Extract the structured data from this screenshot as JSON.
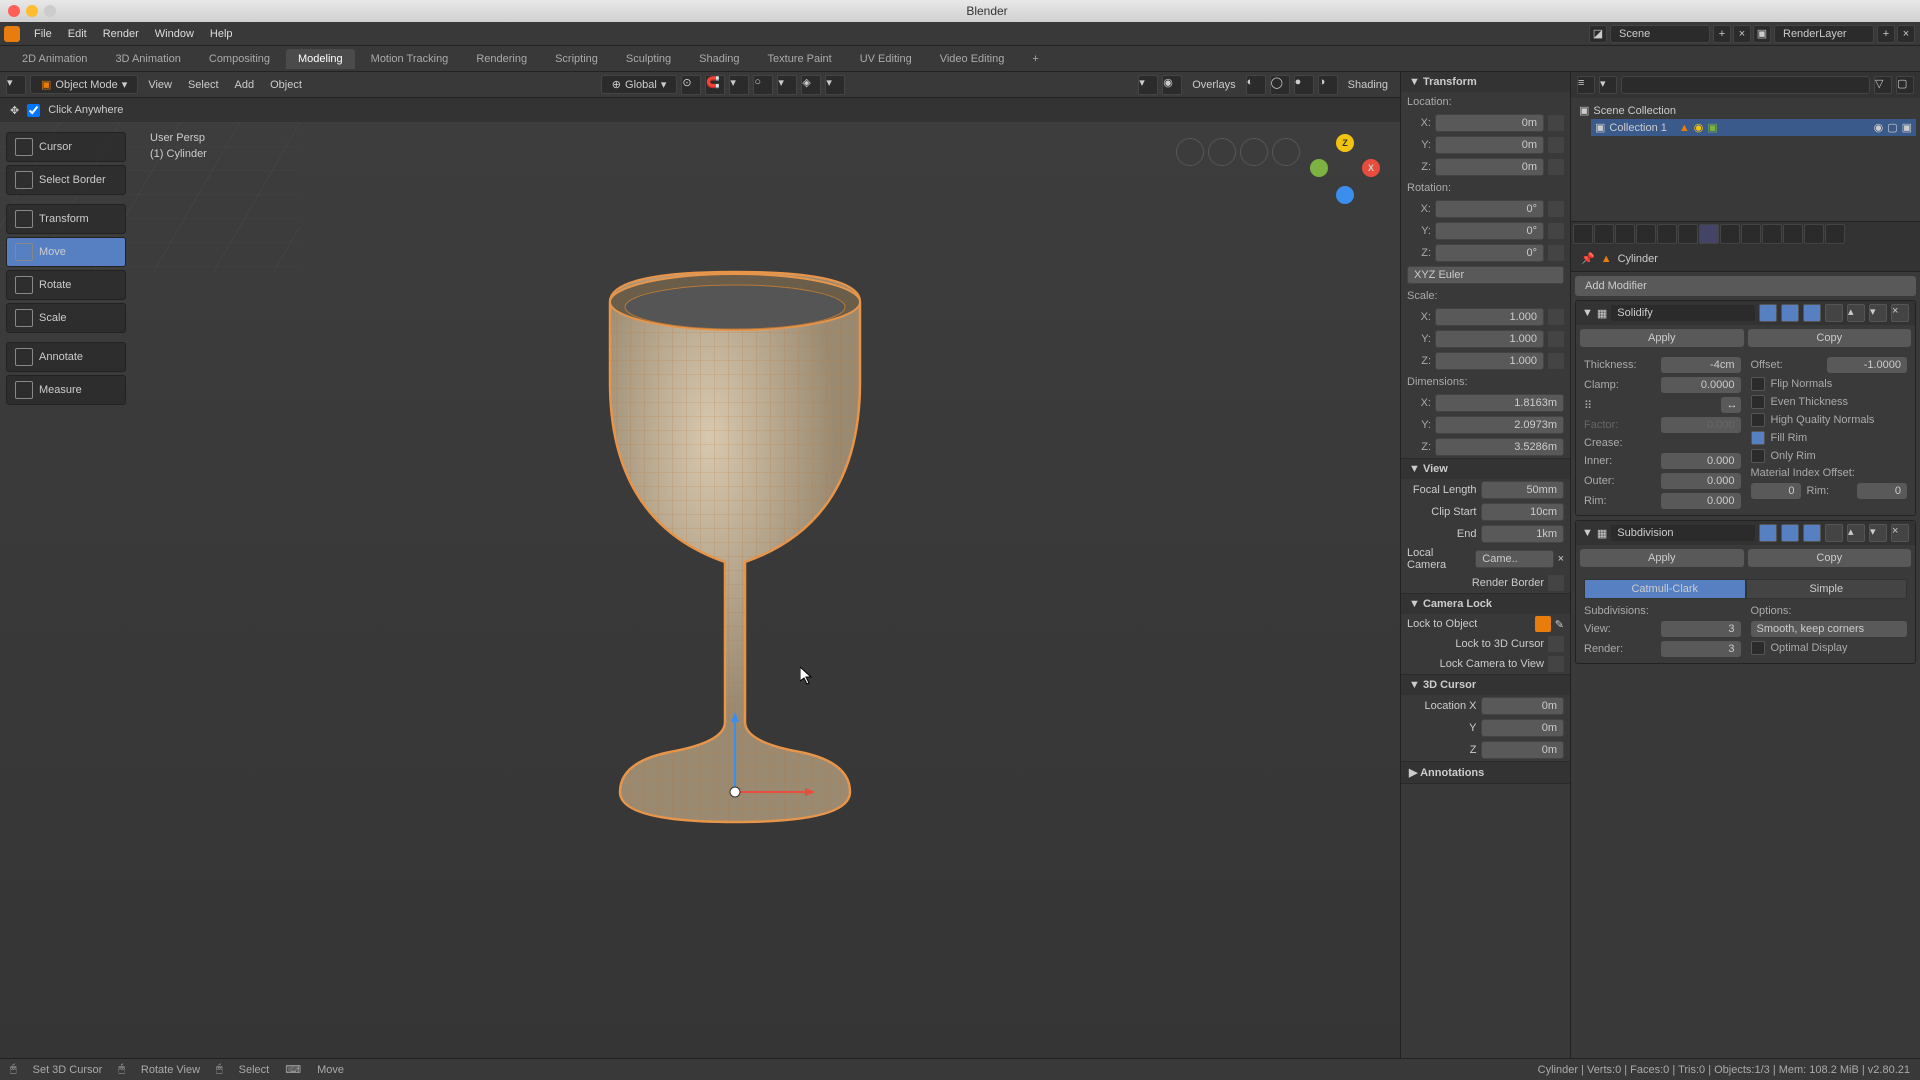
{
  "app": {
    "title": "Blender"
  },
  "menu": [
    "File",
    "Edit",
    "Render",
    "Window",
    "Help"
  ],
  "workspaces": [
    "2D Animation",
    "3D Animation",
    "Compositing",
    "Modeling",
    "Motion Tracking",
    "Rendering",
    "Scripting",
    "Sculpting",
    "Shading",
    "Texture Paint",
    "UV Editing",
    "Video Editing"
  ],
  "activeWorkspace": "Modeling",
  "scene": "Scene",
  "renderLayer": "RenderLayer",
  "vp": {
    "mode": "Object Mode",
    "menus": [
      "View",
      "Select",
      "Add",
      "Object"
    ],
    "orientation": "Global",
    "overlays": "Overlays",
    "shading": "Shading",
    "click": "Click Anywhere",
    "info1": "User Persp",
    "info2": "(1) Cylinder"
  },
  "tools": [
    "Cursor",
    "Select Border",
    "Transform",
    "Move",
    "Rotate",
    "Scale",
    "Annotate",
    "Measure"
  ],
  "activeTool": "Move",
  "n": {
    "transform": "Transform",
    "loc": {
      "h": "Location:",
      "x": "0m",
      "y": "0m",
      "z": "0m"
    },
    "rot": {
      "h": "Rotation:",
      "x": "0°",
      "y": "0°",
      "z": "0°",
      "mode": "XYZ Euler"
    },
    "scale": {
      "h": "Scale:",
      "x": "1.000",
      "y": "1.000",
      "z": "1.000"
    },
    "dim": {
      "h": "Dimensions:",
      "x": "1.8163m",
      "y": "2.0973m",
      "z": "3.5286m"
    },
    "view": {
      "h": "View",
      "focal_l": "Focal Length",
      "focal": "50mm",
      "clipstart_l": "Clip Start",
      "clipstart": "10cm",
      "end_l": "End",
      "end": "1km",
      "localcam_l": "Local Camera",
      "localcam": "Came..",
      "rb": "Render Border"
    },
    "camlock": {
      "h": "Camera Lock",
      "lto": "Lock to Object",
      "l3d": "Lock to 3D Cursor",
      "lcv": "Lock Camera to View"
    },
    "cursor": {
      "h": "3D Cursor",
      "lx": "Location X",
      "x": "0m",
      "y": "0m",
      "z": "0m"
    },
    "ann": "Annotations"
  },
  "outliner": {
    "root": "Scene Collection",
    "c1": "Collection 1"
  },
  "props": {
    "object": "Cylinder",
    "addmod": "Add Modifier"
  },
  "mod1": {
    "name": "Solidify",
    "apply": "Apply",
    "copy": "Copy",
    "thickness_l": "Thickness:",
    "thickness": "-4cm",
    "offset_l": "Offset:",
    "offset": "-1.0000",
    "clamp_l": "Clamp:",
    "clamp": "0.0000",
    "flip": "Flip Normals",
    "even": "Even Thickness",
    "hqn": "High Quality Normals",
    "fill": "Fill Rim",
    "only": "Only Rim",
    "factor_l": "Factor:",
    "factor": "0.000",
    "crease": "Crease:",
    "inner_l": "Inner:",
    "inner": "0.000",
    "outer_l": "Outer:",
    "outer": "0.000",
    "rim_l": "Rim:",
    "rim": "0.000",
    "mio": "Material Index Offset:",
    "mio_v": "0",
    "mio_rim": "Rim:",
    "mio_rimv": "0"
  },
  "mod2": {
    "name": "Subdivision",
    "apply": "Apply",
    "copy": "Copy",
    "cc": "Catmull-Clark",
    "simple": "Simple",
    "subdivs": "Subdivisions:",
    "options": "Options:",
    "view_l": "View:",
    "view": "3",
    "render_l": "Render:",
    "render": "3",
    "smooth": "Smooth, keep corners",
    "optimal": "Optimal Display"
  },
  "status": {
    "a": "Set 3D Cursor",
    "b": "Rotate View",
    "c": "Select",
    "d": "Move",
    "stats": "Cylinder | Verts:0 | Faces:0 | Tris:0 | Objects:1/3 | Mem: 108.2 MiB | v2.80.21"
  }
}
